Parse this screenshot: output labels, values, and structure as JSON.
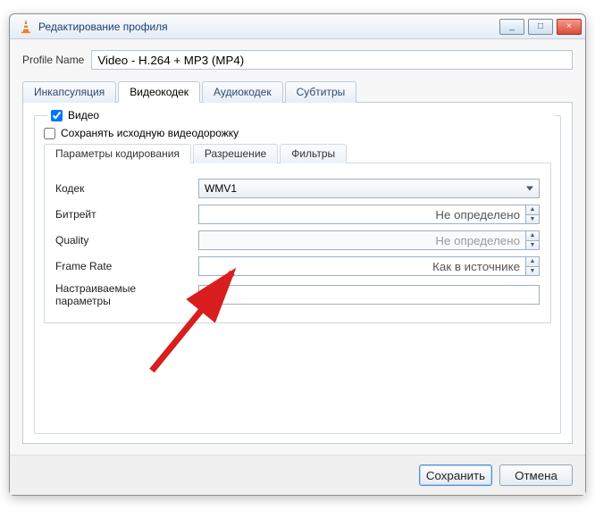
{
  "window": {
    "title": "Редактирование профиля",
    "min_label": "_",
    "max_label": "□",
    "close_label": "×"
  },
  "profile": {
    "label": "Profile Name",
    "value": "Video - H.264 + MP3 (MP4)"
  },
  "tabs": {
    "encapsulation": "Инкапсуляция",
    "video_codec": "Видеокодек",
    "audio_codec": "Аудиокодек",
    "subtitles": "Субтитры"
  },
  "video": {
    "checkbox_label": "Видео",
    "checkbox_checked": true,
    "keep_original_label": "Сохранять исходную видеодорожку",
    "keep_original_checked": false
  },
  "subtabs": {
    "encoding": "Параметры кодирования",
    "resolution": "Разрешение",
    "filters": "Фильтры"
  },
  "form": {
    "codec": {
      "label": "Кодек",
      "value": "WMV1"
    },
    "bitrate": {
      "label": "Битрейт",
      "value": "Не определено"
    },
    "quality": {
      "label": "Quality",
      "value": "Не определено"
    },
    "framerate": {
      "label": "Frame Rate",
      "value": "Как в источнике"
    },
    "custom": {
      "label": "Настраиваемые параметры",
      "value": ""
    }
  },
  "footer": {
    "save": "Сохранить",
    "cancel": "Отмена"
  }
}
